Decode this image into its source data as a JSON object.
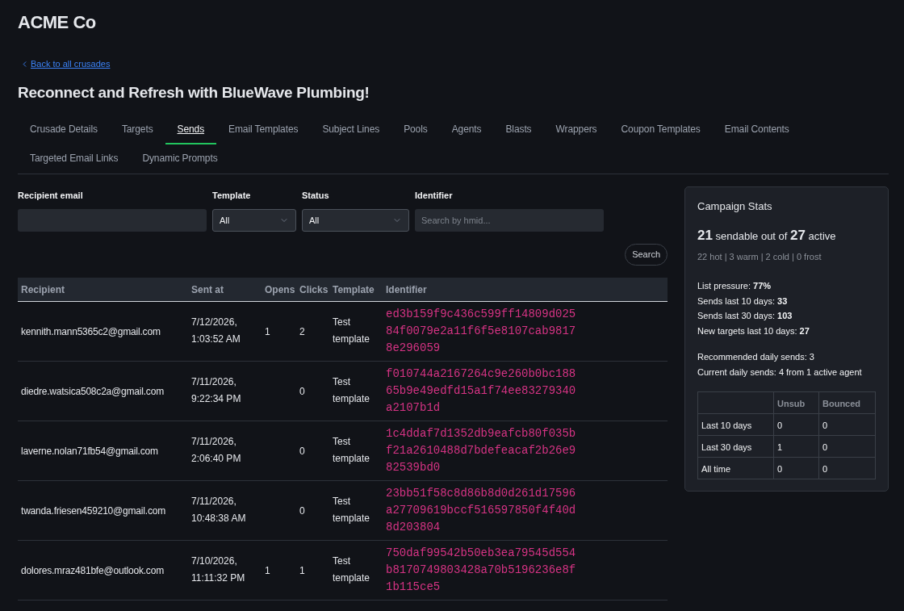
{
  "brand": "ACME Co",
  "back_link": "Back to all crusades",
  "title": "Reconnect and Refresh with BlueWave Plumbing!",
  "tabs": [
    {
      "label": "Crusade Details",
      "selected": false
    },
    {
      "label": "Targets",
      "selected": false
    },
    {
      "label": "Sends",
      "selected": true
    },
    {
      "label": "Email Templates",
      "selected": false
    },
    {
      "label": "Subject Lines",
      "selected": false
    },
    {
      "label": "Pools",
      "selected": false
    },
    {
      "label": "Agents",
      "selected": false
    },
    {
      "label": "Blasts",
      "selected": false
    },
    {
      "label": "Wrappers",
      "selected": false
    },
    {
      "label": "Coupon Templates",
      "selected": false
    },
    {
      "label": "Email Contents",
      "selected": false
    },
    {
      "label": "Targeted Email Links",
      "selected": false
    },
    {
      "label": "Dynamic Prompts",
      "selected": false
    }
  ],
  "filters": [
    {
      "kind": "text",
      "label": "Recipient email"
    },
    {
      "kind": "select",
      "label": "Template",
      "value": "All"
    },
    {
      "kind": "select",
      "label": "Status",
      "value": "All"
    },
    {
      "kind": "text",
      "label": "Identifier",
      "placeholder": "Search by hmid..."
    }
  ],
  "search_button": "Search",
  "table": {
    "columns": [
      "Recipient",
      "Sent at",
      "Opens",
      "Clicks",
      "Template",
      "Identifier"
    ],
    "rows": [
      {
        "recipient": "kennith.mann5365c2@gmail.com",
        "sent_at": "7/12/2026, 1:03:52 AM",
        "opens": "1",
        "clicks": "2",
        "template": "Test template",
        "identifier": "ed3b159f9c436c599ff14809d02584f0079e2a11f6f5e8107cab98178e296059"
      },
      {
        "recipient": "diedre.watsica508c2a@gmail.com",
        "sent_at": "7/11/2026, 9:22:34 PM",
        "clicks": "0",
        "template": "Test template",
        "identifier": "f010744a2167264c9e260b0bc18865b9e49edfd15a1f74ee83279340a2107b1d"
      },
      {
        "recipient": "laverne.nolan71fb54@gmail.com",
        "sent_at": "7/11/2026, 2:06:40 PM",
        "clicks": "0",
        "template": "Test template",
        "identifier": "1c4ddaf7d1352db9eafcb80f035bf21a2610488d7bdefeacaf2b26e982539bd0"
      },
      {
        "recipient": "twanda.friesen459210@gmail.com",
        "sent_at": "7/11/2026, 10:48:38 AM",
        "clicks": "0",
        "template": "Test template",
        "identifier": "23bb51f58c8d86b8d0d261d17596a27709619bccf516597850f4f40d8d203804"
      },
      {
        "recipient": "dolores.mraz481bfe@outlook.com",
        "sent_at": "7/10/2026, 11:11:32 PM",
        "opens": "1",
        "clicks": "1",
        "template": "Test template",
        "identifier": "750daf99542b50eb3ea79545d554b8170749803428a70b5196236e8f1b115ce5"
      }
    ]
  },
  "stats": {
    "title": "Campaign Stats",
    "headline": "**21** sendable out of **27** active",
    "breakdown": "22 hot | 3 warm | 2 cold | 0 frost",
    "metrics": [
      "List pressure: **77%**",
      "Sends last 10 days: **33**",
      "Sends last 30 days: **103**",
      "New targets last 10 days: **27**"
    ],
    "recommendations": [
      "Recommended daily sends: 3",
      "Current daily sends: 4 from 1 active agent"
    ],
    "table": {
      "columns": [
        "Unsub",
        "Bounced"
      ],
      "rows": [
        {
          "label": "Last 10 days",
          "values": [
            "0",
            "0"
          ]
        },
        {
          "label": "Last 30 days",
          "values": [
            "1",
            "0"
          ]
        },
        {
          "label": "All time",
          "values": [
            "0",
            "0"
          ]
        }
      ]
    }
  }
}
